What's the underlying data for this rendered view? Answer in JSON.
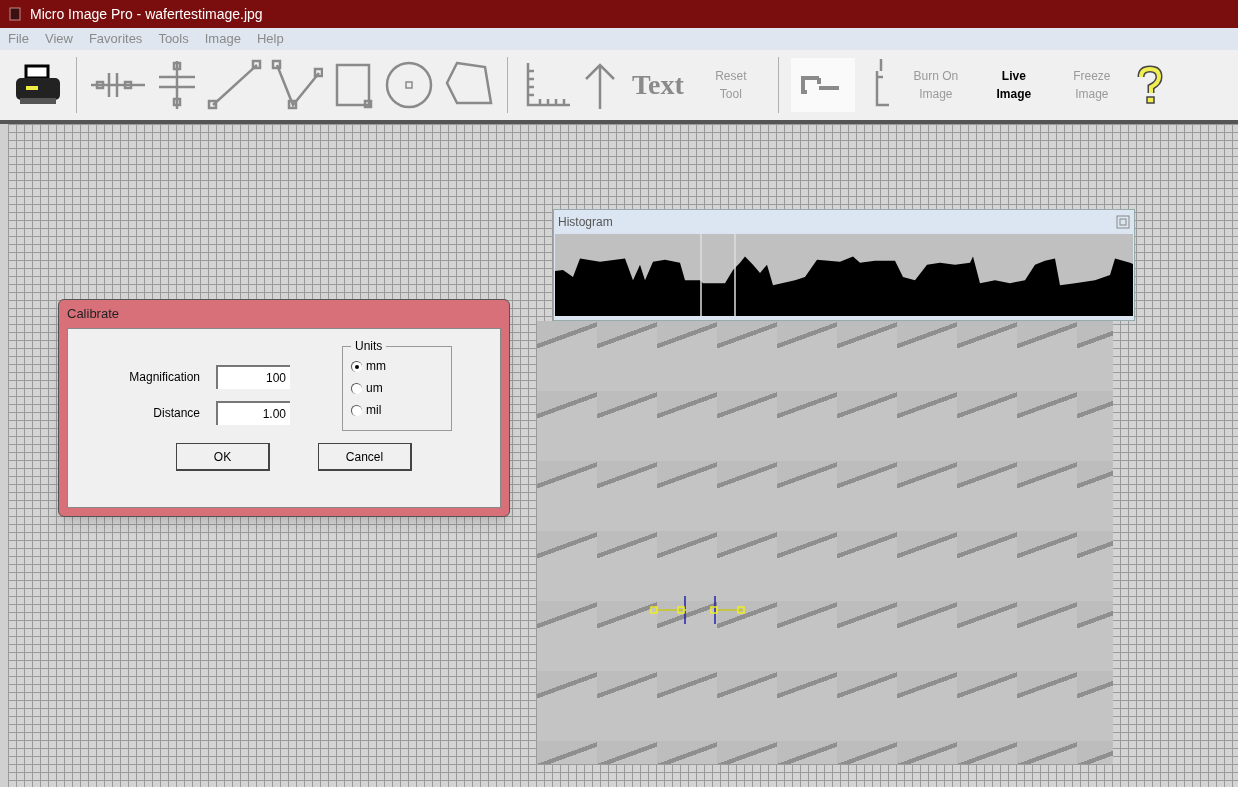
{
  "window": {
    "title": "Micro Image Pro - wafertestimage.jpg"
  },
  "menu": [
    "File",
    "View",
    "Favorites",
    "Tools",
    "Image",
    "Help"
  ],
  "toolbar": {
    "text_tool": "Text",
    "buttons": [
      {
        "label": "Reset Tool",
        "disabled": true
      },
      {
        "label": "Burn On Image",
        "disabled": true
      },
      {
        "label": "Live Image",
        "disabled": false
      },
      {
        "label": "Freeze Image",
        "disabled": true
      }
    ]
  },
  "histogram": {
    "title": "Histogram"
  },
  "dialog": {
    "title": "Calibrate",
    "fields": [
      {
        "label": "Magnification",
        "value": "100"
      },
      {
        "label": "Distance",
        "value": "1.00"
      }
    ],
    "units": {
      "title": "Units",
      "options": [
        {
          "label": "mm",
          "selected": true
        },
        {
          "label": "um",
          "selected": false
        },
        {
          "label": "mil",
          "selected": false
        }
      ]
    },
    "buttons": [
      "OK",
      "Cancel"
    ]
  }
}
